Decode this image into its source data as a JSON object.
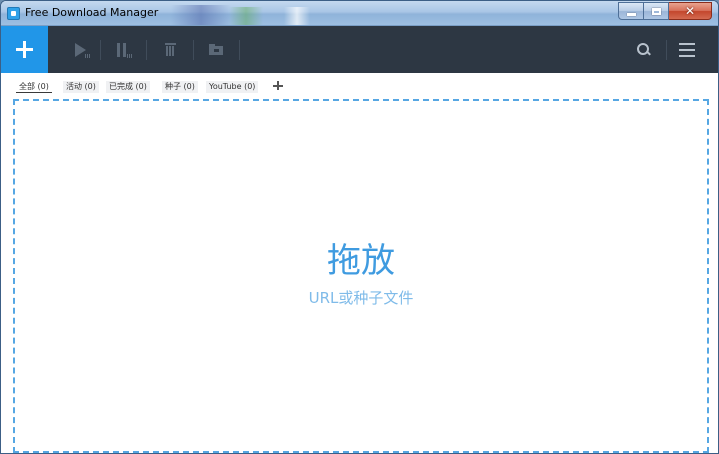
{
  "window": {
    "title": "Free Download Manager"
  },
  "toolbar": {
    "buttons": [
      "add",
      "resume",
      "pause",
      "delete",
      "open-folder",
      "search",
      "menu"
    ]
  },
  "filters": {
    "tabs": [
      {
        "label": "全部 (0)",
        "active": true
      },
      {
        "label": "活动 (0)",
        "active": false
      },
      {
        "label": "已完成 (0)",
        "active": false
      },
      {
        "label": "种子 (0)",
        "active": false
      },
      {
        "label": "YouTube (0)",
        "active": false
      }
    ]
  },
  "dropzone": {
    "title": "拖放",
    "subtitle": "URL或种子文件"
  },
  "colors": {
    "toolbar_bg": "#2d3743",
    "accent": "#2196e8",
    "drop_text": "#3f9be0"
  }
}
